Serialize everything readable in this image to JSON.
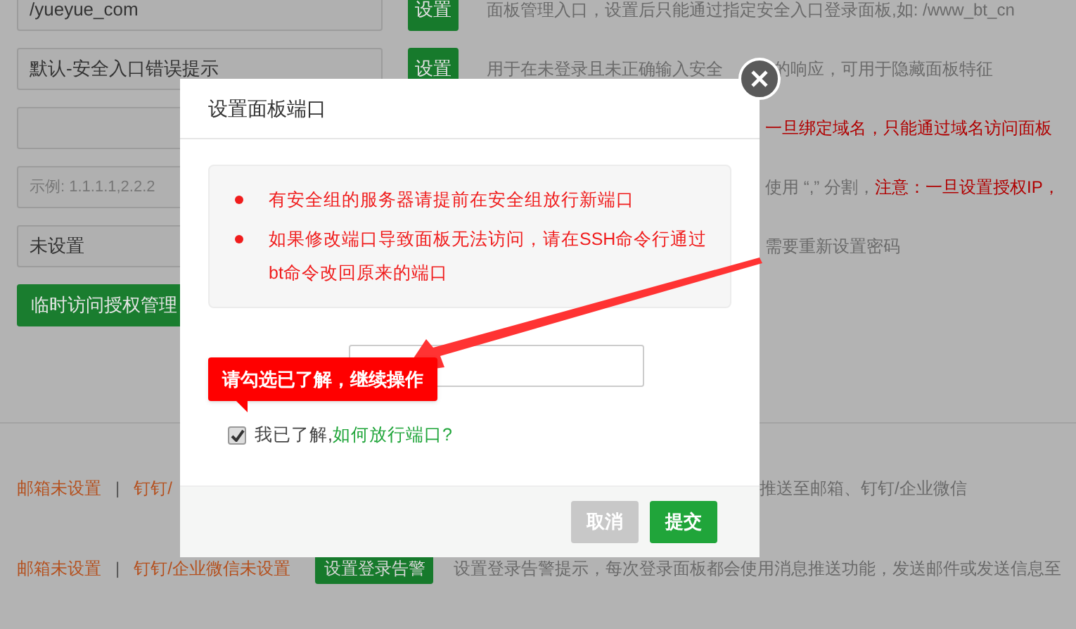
{
  "settings": [
    {
      "kind": "field",
      "value": "/yueyue_com",
      "button": "设置",
      "note": "面板管理入口，设置后只能通过指定安全入口登录面板,如: /www_bt_cn"
    },
    {
      "kind": "field",
      "value": "默认-安全入口错误提示",
      "button": "设置",
      "note": "用于在未登录且未正确输入安全",
      "note_tail": "的响应，可用于隐藏面板特征"
    },
    {
      "kind": "field",
      "warn_tail": "一旦绑定域名，只能通过域名访问面板"
    },
    {
      "kind": "field",
      "placeholder": "示例: 1.1.1.1,2.2.2",
      "note_tail": "使用 “,” 分割，",
      "warn_tail": "注意：一旦设置授权IP，"
    },
    {
      "kind": "field",
      "value": "未设置",
      "note_tail": "需要重新设置密码"
    },
    {
      "kind": "action",
      "button": "临时访问授权管理"
    }
  ],
  "alerts": [
    {
      "mail": "邮箱未设置",
      "separator": "|",
      "dingtalk": "钉钉/",
      "note_tail": "推送至邮箱、钉钉/企业微信"
    },
    {
      "mail": "邮箱未设置",
      "separator": "|",
      "dingtalk": "钉钉/企业微信未设置",
      "button": "设置登录告警",
      "note": "设置登录告警提示，每次登录面板都会使用消息推送功能，发送邮件或发送信息至"
    }
  ],
  "dialog": {
    "title": "设置面板端口",
    "notices": [
      "有安全组的服务器请提前在安全组放行新端口",
      "如果修改端口导致面板无法访问，请在SSH命令行通过bt命令改回原来的端口"
    ],
    "tooltip": "请勾选已了解，继续操作",
    "acknowledge": {
      "checked": true,
      "label": "我已了解,",
      "link": "如何放行端口?"
    },
    "buttons": [
      {
        "kind": "cancel",
        "label": "取消"
      },
      {
        "kind": "submit",
        "label": "提交"
      }
    ]
  }
}
